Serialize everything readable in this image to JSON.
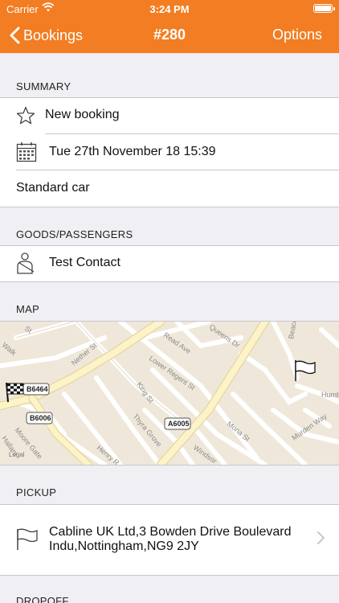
{
  "status_bar": {
    "carrier": "Carrier",
    "time": "3:24 PM"
  },
  "nav": {
    "back_label": "Bookings",
    "title": "#280",
    "options_label": "Options"
  },
  "summary": {
    "label": "SUMMARY",
    "status": "New booking",
    "datetime": "Tue 27th November 18 15:39",
    "vehicle": "Standard car"
  },
  "goods": {
    "label": "GOODS/PASSENGERS",
    "contact": "Test Contact"
  },
  "map": {
    "label": "MAP",
    "legal": "Legal",
    "streets": {
      "walk": "Walk",
      "st": "St",
      "read_ave": "Read Ave",
      "queens_dr": "Queens Dr",
      "beacon_rd": "Beacon Rd",
      "lower_regent_st": "Lower Regent St",
      "nether_st": "Nether St",
      "king_st": "King St",
      "thyra_grove": "Thyra Grove",
      "mona_st": "Mona St",
      "henry_rd": "Henry R",
      "moore_gate": "Moore Gate",
      "hallam": "Hallam",
      "windsor": "Windsor",
      "murden_way": "Murden Way",
      "humb": "Humb"
    },
    "road_badges": {
      "b6464": "B6464",
      "b6006": "B6006",
      "a6005": "A6005"
    }
  },
  "pickup": {
    "label": "PICKUP",
    "address": "Cabline UK Ltd,3 Bowden Drive  Boulevard Indu,Nottingham,NG9 2JY"
  },
  "dropoff": {
    "label": "DROPOFF"
  },
  "colors": {
    "brand": "#f27d22",
    "background": "#efeff4",
    "separator": "#c8c7cc"
  },
  "icons": {
    "back": "chevron-left-icon",
    "status": "star-icon",
    "date": "calendar-icon",
    "contact": "person-icon",
    "start_marker": "checkered-flag-icon",
    "end_marker": "flag-icon",
    "pickup": "flag-icon",
    "disclosure": "chevron-right-icon"
  }
}
